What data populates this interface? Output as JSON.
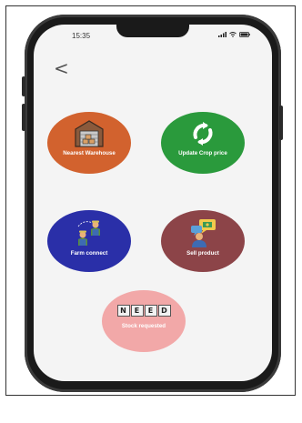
{
  "status": {
    "time": "15:35"
  },
  "nav": {
    "back_symbol": "<"
  },
  "actions": [
    {
      "label": "Nearest Warehouse",
      "color": "#d2622e",
      "icon": "warehouse-icon"
    },
    {
      "label": "Update Crop price",
      "color": "#2a9a3c",
      "icon": "refresh-icon"
    },
    {
      "label": "Farm connect",
      "color": "#2a2fa8",
      "icon": "farmers-icon"
    },
    {
      "label": "Sell product",
      "color": "#8c4448",
      "icon": "seller-chat-icon"
    },
    {
      "label": "Stock requested",
      "color": "#f2a8a8",
      "icon": "need-icon",
      "badge": [
        "N",
        "E",
        "E",
        "D"
      ]
    }
  ]
}
